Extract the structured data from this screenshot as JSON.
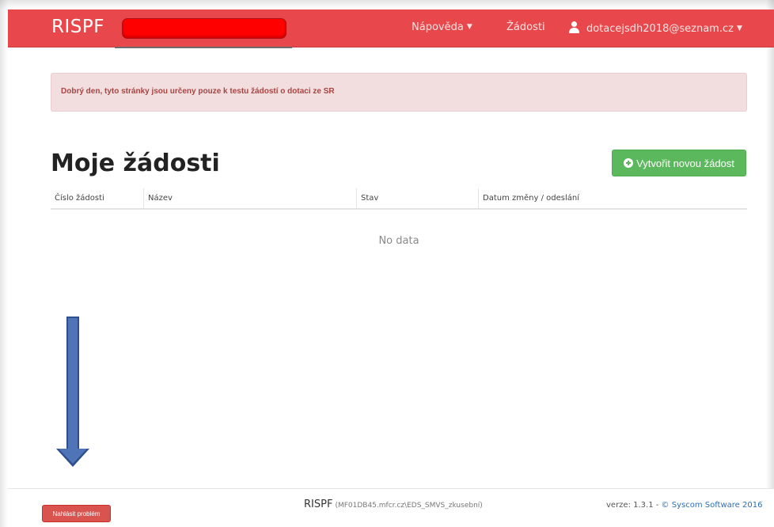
{
  "navbar": {
    "brand": "RISPF",
    "help_label": "Nápověda",
    "requests_label": "Žádosti",
    "user_email": "dotacejsdh2018@seznam.cz",
    "redaction_color": "#ff0000",
    "background_color": "#e8484b"
  },
  "alert": {
    "text": "Dobrý den, tyto stránky jsou určeny pouze k testu žádostí o dotaci ze SR"
  },
  "main": {
    "title": "Moje žádosti",
    "create_button_label": "Vytvořit novou žádost",
    "table": {
      "columns": [
        "Číslo žádosti",
        "Název",
        "Stav",
        "Datum změny / odeslání"
      ],
      "rows": [],
      "empty_text": "No data"
    }
  },
  "annotation": {
    "type": "down-arrow",
    "color": "#4f74b8"
  },
  "footer": {
    "report_button_label": "Nahlásit problém",
    "app_name": "RISPF",
    "server": "(MF01DB45.mfcr.cz\\EDS_SMVS_zkusební)",
    "version_prefix": "verze: 1.3.1 - ",
    "copyright_link": "© Syscom Software 2016"
  },
  "icons": {
    "user": "user-icon",
    "create": "plus-circle-icon",
    "dropdown": "caret-down-icon"
  },
  "colors": {
    "primary_red": "#e8484b",
    "success_green": "#5cb85c",
    "danger_red": "#d9534f",
    "alert_bg": "#f2dede",
    "alert_text": "#a94442"
  }
}
